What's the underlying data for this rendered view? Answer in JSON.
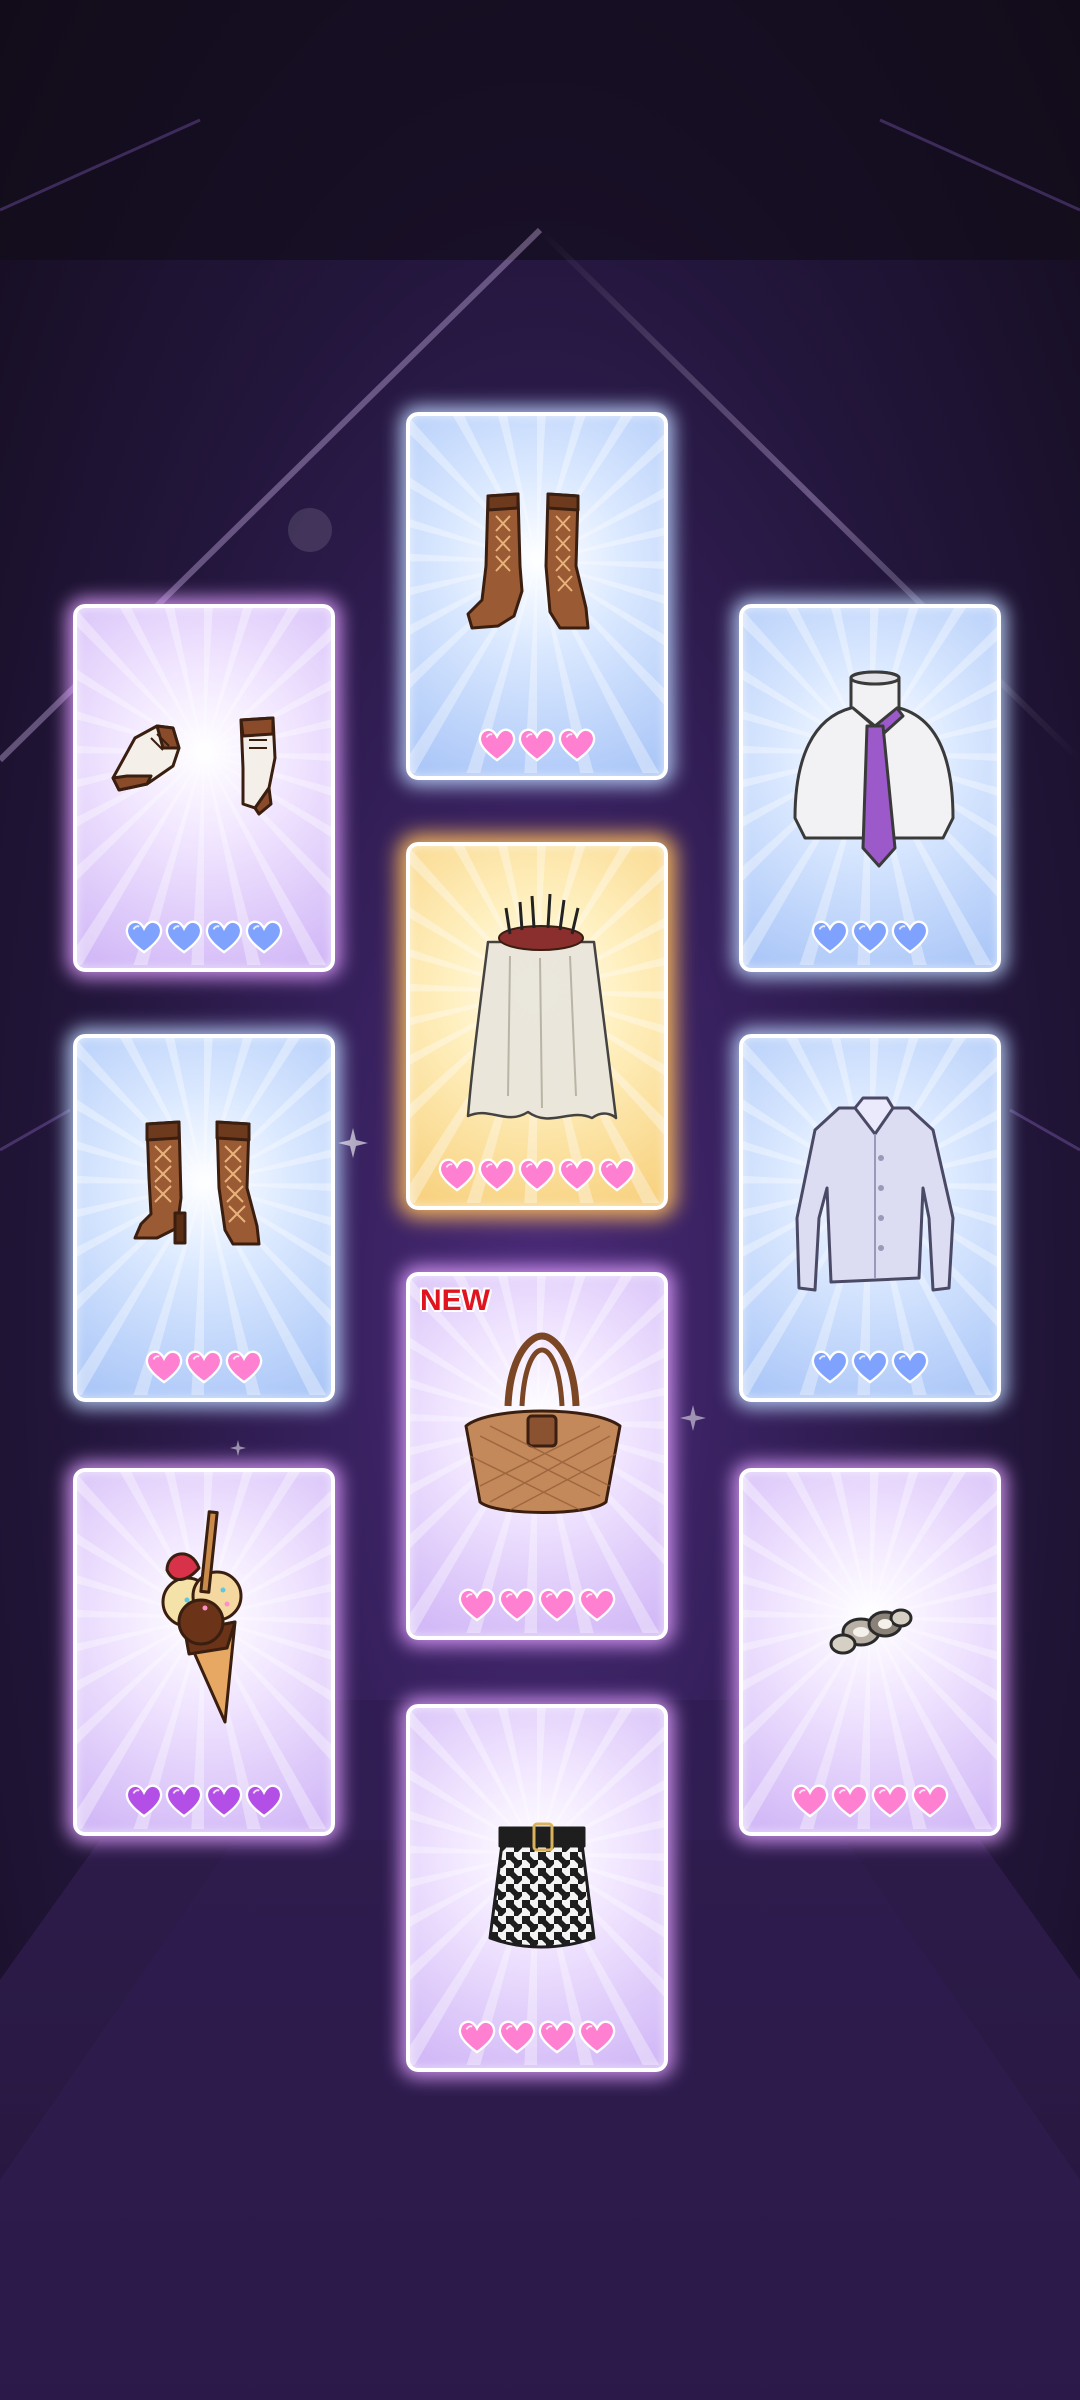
{
  "colors": {
    "heart_pink": "#ff7fd0",
    "heart_blue": "#7fa2ff",
    "heart_purple": "#b34fe6",
    "card_blue": "#a7c4f7",
    "card_pink": "#cfb4f6",
    "card_gold": "#f7cf7a"
  },
  "cards": [
    {
      "item_icon": "lace-up-boots-icon",
      "frame": "blue",
      "heart_color": "pink",
      "hearts": 3,
      "badge": ""
    },
    {
      "item_icon": "oxford-shoes-icon",
      "frame": "pink",
      "heart_color": "blue",
      "hearts": 4,
      "badge": ""
    },
    {
      "item_icon": "necktie-icon",
      "frame": "blue",
      "heart_color": "blue",
      "hearts": 3,
      "badge": ""
    },
    {
      "item_icon": "crown-veil-icon",
      "frame": "gold",
      "heart_color": "pink",
      "hearts": 5,
      "badge": ""
    },
    {
      "item_icon": "heeled-boots-icon",
      "frame": "blue",
      "heart_color": "pink",
      "hearts": 3,
      "badge": ""
    },
    {
      "item_icon": "dress-shirt-icon",
      "frame": "blue",
      "heart_color": "blue",
      "hearts": 3,
      "badge": ""
    },
    {
      "item_icon": "woven-tote-bag-icon",
      "frame": "pink",
      "heart_color": "pink",
      "hearts": 4,
      "badge": "NEW"
    },
    {
      "item_icon": "ice-cream-cone-icon",
      "frame": "pink",
      "heart_color": "purple",
      "hearts": 4,
      "badge": ""
    },
    {
      "item_icon": "bracelet-icon",
      "frame": "pink",
      "heart_color": "pink",
      "hearts": 4,
      "badge": ""
    },
    {
      "item_icon": "houndstooth-skirt-icon",
      "frame": "pink",
      "heart_color": "pink",
      "hearts": 4,
      "badge": ""
    }
  ]
}
